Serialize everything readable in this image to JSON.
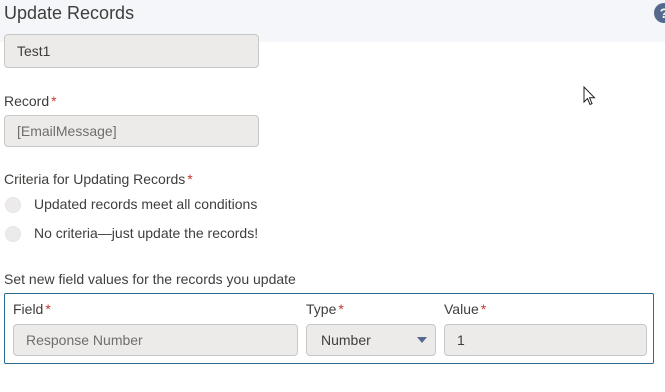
{
  "header": {
    "title": "Update Records",
    "help_icon": "question-circle-icon",
    "help_glyph": "?"
  },
  "name_field": {
    "value": "Test1"
  },
  "record": {
    "label": "Record",
    "required_mark": "*",
    "value": "[EmailMessage]"
  },
  "criteria": {
    "label": "Criteria for Updating Records",
    "required_mark": "*",
    "options": [
      {
        "label": "Updated records meet all conditions"
      },
      {
        "label": "No criteria—just update the records!"
      }
    ]
  },
  "field_values": {
    "label": "Set new field values for the records you update",
    "field_label": "Field",
    "type_label": "Type",
    "value_label": "Value",
    "required_mark": "*",
    "row": {
      "field": "Response Number",
      "type": "Number",
      "value": "1"
    }
  },
  "colors": {
    "required": "#c23934",
    "group_border": "#2a6a8e",
    "help_bg": "#54698d"
  }
}
